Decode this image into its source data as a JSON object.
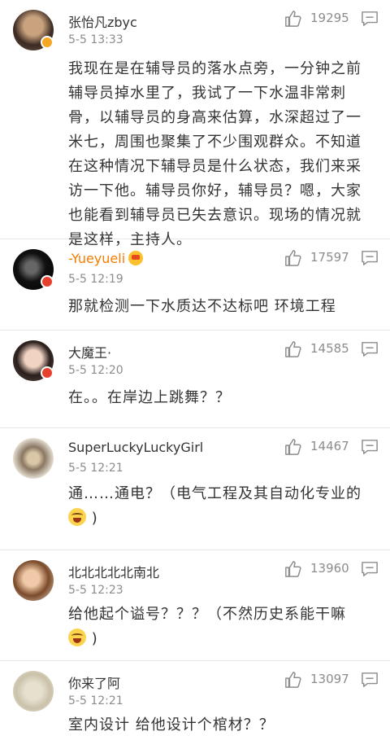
{
  "comments": [
    {
      "name": "张怡凡zbyc",
      "time": "5-5 13:33",
      "likes": "19295",
      "text": [
        "我现在是在辅导员的落水点旁，一分钟之前",
        "辅导员掉水里了，我试了一下水温非常刺",
        "骨，以辅导员的身高来估算，水深超过了一",
        "米七，周围也聚集了不少围观群众。不知道",
        "在这种情况下辅导员是什么状态，我们来采",
        "访一下他。辅导员你好，辅导员？嗯，大家",
        "也能看到辅导员已失去意识。现场的情况就",
        "是这样，主持人。"
      ]
    },
    {
      "name": "-Yueyueli",
      "time": "5-5 12:19",
      "likes": "17597",
      "text": [
        "那就检测一下水质达不达标吧  环境工程"
      ]
    },
    {
      "name": "大魔王·",
      "time": "5-5 12:20",
      "likes": "14585",
      "text": [
        "在。。在岸边上跳舞？？"
      ]
    },
    {
      "name": "SuperLuckyLuckyGirl",
      "time": "5-5 12:21",
      "likes": "14467",
      "text": [
        "通……通电？（电气工程及其自动化专业的",
        ")"
      ]
    },
    {
      "name": "北北北北北南北",
      "time": "5-5 12:23",
      "likes": "13960",
      "text": [
        "给他起个谥号？？？（不然历史系能干嘛",
        ")"
      ]
    },
    {
      "name": "你来了阿",
      "time": "5-5 12:21",
      "likes": "13097",
      "text": [
        "室内设计 给他设计个棺材？？"
      ]
    }
  ],
  "colors": {
    "name_highlight": "#f57c00",
    "meta": "#8c8c8c",
    "text": "#333333"
  },
  "icons": {
    "like": "thumbs-up-icon",
    "reply": "comment-icon",
    "emoji": "laughing-tears-emoji"
  }
}
